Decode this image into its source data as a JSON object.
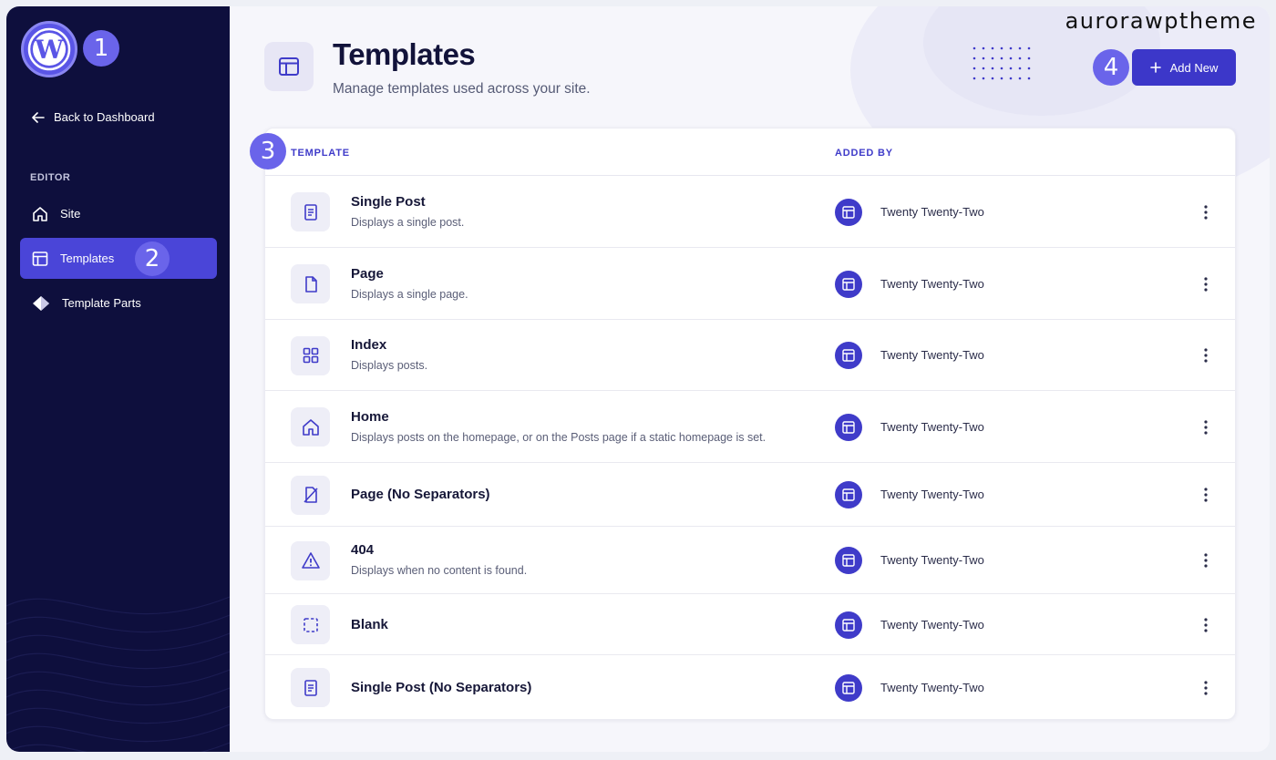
{
  "watermark": "aurorawptheme",
  "markers": {
    "one": "1",
    "two": "2",
    "three": "3",
    "four": "4"
  },
  "sidebar": {
    "logo_icon": "wordpress-icon",
    "back_label": "Back to Dashboard",
    "section_label": "EDITOR",
    "items": [
      {
        "label": "Site",
        "icon": "home-icon",
        "active": false
      },
      {
        "label": "Templates",
        "icon": "layout-icon",
        "active": true
      },
      {
        "label": "Template Parts",
        "icon": "diamond-icon",
        "active": false
      }
    ]
  },
  "header": {
    "icon": "layout-icon",
    "title": "Templates",
    "subtitle": "Manage templates used across your site.",
    "add_button": "Add New"
  },
  "table": {
    "columns": [
      "TEMPLATE",
      "ADDED BY"
    ],
    "rows": [
      {
        "name": "Single Post",
        "description": "Displays a single post.",
        "icon": "post-icon",
        "added_by": "Twenty Twenty-Two"
      },
      {
        "name": "Page",
        "description": "Displays a single page.",
        "icon": "page-icon",
        "added_by": "Twenty Twenty-Two"
      },
      {
        "name": "Index",
        "description": "Displays posts.",
        "icon": "grid-icon",
        "added_by": "Twenty Twenty-Two"
      },
      {
        "name": "Home",
        "description": "Displays posts on the homepage, or on the Posts page if a static homepage is set.",
        "icon": "home-icon",
        "added_by": "Twenty Twenty-Two"
      },
      {
        "name": "Page (No Separators)",
        "description": "",
        "icon": "page-no-separators-icon",
        "added_by": "Twenty Twenty-Two"
      },
      {
        "name": "404",
        "description": "Displays when no content is found.",
        "icon": "warning-icon",
        "added_by": "Twenty Twenty-Two"
      },
      {
        "name": "Blank",
        "description": "",
        "icon": "dashed-square-icon",
        "added_by": "Twenty Twenty-Two"
      },
      {
        "name": "Single Post (No Separators)",
        "description": "",
        "icon": "post-icon",
        "added_by": "Twenty Twenty-Two"
      }
    ]
  },
  "colors": {
    "sidebar": "#0e0f3d",
    "accent": "#3f3bc9",
    "active": "#4a45d8",
    "badge": "#6a64ea"
  }
}
